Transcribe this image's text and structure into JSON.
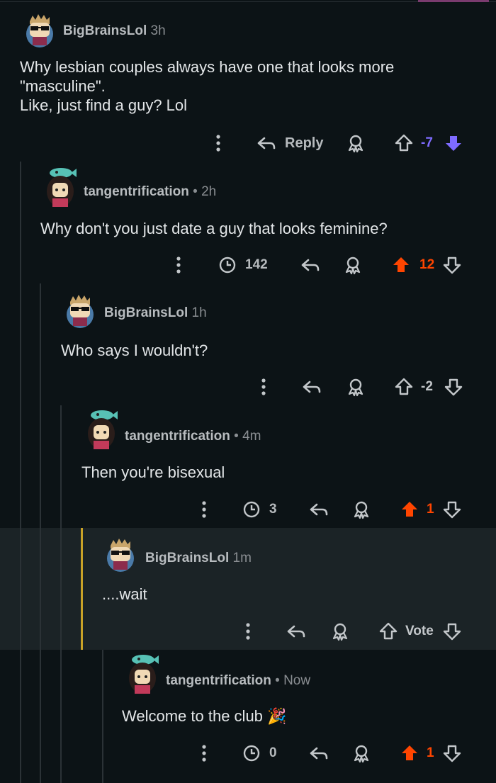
{
  "comments": [
    {
      "user": "BigBrainsLol",
      "time": "3h",
      "body": "Why lesbian couples always have one that looks more \"masculine\".\nLike, just find a guy? Lol",
      "reply_label": "Reply",
      "score": "-7",
      "vote": "down",
      "avatar": "sunglasses-avatar"
    },
    {
      "user": "tangentrification",
      "time": "2h",
      "body": "Why don't you just date a guy that looks feminine?",
      "award_count": "142",
      "score": "12",
      "vote": "up",
      "avatar": "fish-hat-avatar"
    },
    {
      "user": "BigBrainsLol",
      "time": "1h",
      "body": "Who says I wouldn't?",
      "score": "-2",
      "vote": "none",
      "avatar": "sunglasses-avatar"
    },
    {
      "user": "tangentrification",
      "time": "4m",
      "body": "Then you're bisexual",
      "award_count": "3",
      "score": "1",
      "vote": "up",
      "avatar": "fish-hat-avatar"
    },
    {
      "user": "BigBrainsLol",
      "time": "1m",
      "body": "....wait",
      "score": "Vote",
      "vote": "none",
      "avatar": "sunglasses-avatar",
      "highlighted": true
    },
    {
      "user": "tangentrification",
      "time": "Now",
      "body": "Welcome to the club 🎉",
      "award_count": "0",
      "score": "1",
      "vote": "up",
      "avatar": "fish-hat-avatar"
    }
  ],
  "separator": "•",
  "colors": {
    "upvote": "#ff4500",
    "downvote": "#7e6bff",
    "bg": "#0c1316",
    "highlight": "#1b2326"
  }
}
